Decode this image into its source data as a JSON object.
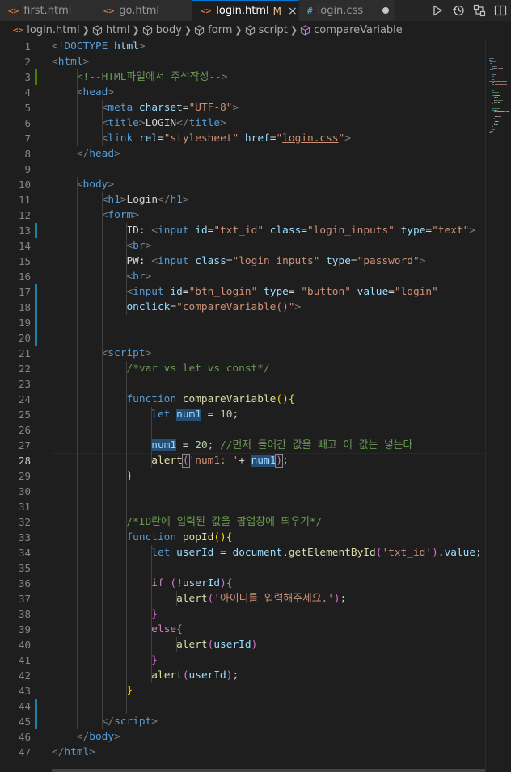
{
  "tabs": [
    {
      "label": "first.html",
      "icon": "<>",
      "type": "html",
      "active": false
    },
    {
      "label": "go.html",
      "icon": "<>",
      "type": "html",
      "active": false
    },
    {
      "label": "login.html",
      "icon": "<>",
      "type": "html",
      "active": true,
      "modified": "M",
      "close": "×"
    },
    {
      "label": "login.css",
      "icon": "#",
      "type": "css",
      "active": false,
      "dirty": true
    }
  ],
  "breadcrumb": [
    "login.html",
    "html",
    "body",
    "form",
    "script",
    "compareVariable"
  ],
  "current_line": 28,
  "lines": [
    {
      "n": 1,
      "t": [
        [
          "br",
          "<!"
        ],
        [
          "tag",
          "DOCTYPE"
        ],
        [
          "txt",
          " "
        ],
        [
          "attr",
          "html"
        ],
        [
          "br",
          ">"
        ]
      ]
    },
    {
      "n": 2,
      "t": [
        [
          "br",
          "<"
        ],
        [
          "tag",
          "html"
        ],
        [
          "br",
          ">"
        ]
      ]
    },
    {
      "n": 3,
      "g": "add",
      "t": [
        [
          "txt",
          "    "
        ],
        [
          "com",
          "<!--HTML파일에서 주석작성-->"
        ]
      ]
    },
    {
      "n": 4,
      "t": [
        [
          "txt",
          "    "
        ],
        [
          "br",
          "<"
        ],
        [
          "tag",
          "head"
        ],
        [
          "br",
          ">"
        ]
      ]
    },
    {
      "n": 5,
      "t": [
        [
          "txt",
          "        "
        ],
        [
          "br",
          "<"
        ],
        [
          "tag",
          "meta"
        ],
        [
          "txt",
          " "
        ],
        [
          "attr",
          "charset"
        ],
        [
          "txt",
          "="
        ],
        [
          "str",
          "\"UTF-8\""
        ],
        [
          "br",
          ">"
        ]
      ]
    },
    {
      "n": 6,
      "t": [
        [
          "txt",
          "        "
        ],
        [
          "br",
          "<"
        ],
        [
          "tag",
          "title"
        ],
        [
          "br",
          ">"
        ],
        [
          "txt",
          "LOGIN"
        ],
        [
          "br",
          "</"
        ],
        [
          "tag",
          "title"
        ],
        [
          "br",
          ">"
        ]
      ]
    },
    {
      "n": 7,
      "t": [
        [
          "txt",
          "        "
        ],
        [
          "br",
          "<"
        ],
        [
          "tag",
          "link"
        ],
        [
          "txt",
          " "
        ],
        [
          "attr",
          "rel"
        ],
        [
          "txt",
          "="
        ],
        [
          "str",
          "\"stylesheet\""
        ],
        [
          "txt",
          " "
        ],
        [
          "attr",
          "href"
        ],
        [
          "txt",
          "="
        ],
        [
          "str",
          "\""
        ],
        [
          "strul",
          "login.css"
        ],
        [
          "str",
          "\""
        ],
        [
          "br",
          ">"
        ]
      ]
    },
    {
      "n": 8,
      "t": [
        [
          "txt",
          "    "
        ],
        [
          "br",
          "</"
        ],
        [
          "tag",
          "head"
        ],
        [
          "br",
          ">"
        ]
      ]
    },
    {
      "n": 9,
      "t": []
    },
    {
      "n": 10,
      "t": [
        [
          "txt",
          "    "
        ],
        [
          "br",
          "<"
        ],
        [
          "tag",
          "body"
        ],
        [
          "br",
          ">"
        ]
      ]
    },
    {
      "n": 11,
      "t": [
        [
          "txt",
          "        "
        ],
        [
          "br",
          "<"
        ],
        [
          "tag",
          "h1"
        ],
        [
          "br",
          ">"
        ],
        [
          "txt",
          "Login"
        ],
        [
          "br",
          "</"
        ],
        [
          "tag",
          "h1"
        ],
        [
          "br",
          ">"
        ]
      ]
    },
    {
      "n": 12,
      "t": [
        [
          "txt",
          "        "
        ],
        [
          "br",
          "<"
        ],
        [
          "tag",
          "form"
        ],
        [
          "br",
          ">"
        ]
      ]
    },
    {
      "n": 13,
      "g": "mod",
      "t": [
        [
          "txt",
          "            ID: "
        ],
        [
          "br",
          "<"
        ],
        [
          "tag",
          "input"
        ],
        [
          "txt",
          " "
        ],
        [
          "attr",
          "id"
        ],
        [
          "txt",
          "="
        ],
        [
          "str",
          "\"txt_id\""
        ],
        [
          "txt",
          " "
        ],
        [
          "attr",
          "class"
        ],
        [
          "txt",
          "="
        ],
        [
          "str",
          "\"login_inputs\""
        ],
        [
          "txt",
          " "
        ],
        [
          "attr",
          "type"
        ],
        [
          "txt",
          "="
        ],
        [
          "str",
          "\"text\""
        ],
        [
          "br",
          ">"
        ]
      ]
    },
    {
      "n": 14,
      "t": [
        [
          "txt",
          "            "
        ],
        [
          "br",
          "<"
        ],
        [
          "tag",
          "br"
        ],
        [
          "br",
          ">"
        ]
      ]
    },
    {
      "n": 15,
      "t": [
        [
          "txt",
          "            PW: "
        ],
        [
          "br",
          "<"
        ],
        [
          "tag",
          "input"
        ],
        [
          "txt",
          " "
        ],
        [
          "attr",
          "class"
        ],
        [
          "txt",
          "="
        ],
        [
          "str",
          "\"login_inputs\""
        ],
        [
          "txt",
          " "
        ],
        [
          "attr",
          "type"
        ],
        [
          "txt",
          "="
        ],
        [
          "str",
          "\"password\""
        ],
        [
          "br",
          ">"
        ]
      ]
    },
    {
      "n": 16,
      "t": [
        [
          "txt",
          "            "
        ],
        [
          "br",
          "<"
        ],
        [
          "tag",
          "br"
        ],
        [
          "br",
          ">"
        ]
      ]
    },
    {
      "n": 17,
      "g": "mod",
      "t": [
        [
          "txt",
          "            "
        ],
        [
          "br",
          "<"
        ],
        [
          "tag",
          "input"
        ],
        [
          "txt",
          " "
        ],
        [
          "attr",
          "id"
        ],
        [
          "txt",
          "="
        ],
        [
          "str",
          "\"btn_login\""
        ],
        [
          "txt",
          " "
        ],
        [
          "attr",
          "type"
        ],
        [
          "txt",
          "= "
        ],
        [
          "str",
          "\"button\""
        ],
        [
          "txt",
          " "
        ],
        [
          "attr",
          "value"
        ],
        [
          "txt",
          "="
        ],
        [
          "str",
          "\"login\""
        ]
      ]
    },
    {
      "n": 18,
      "g": "mod",
      "t": [
        [
          "txt",
          "            "
        ],
        [
          "attr",
          "onclick"
        ],
        [
          "txt",
          "="
        ],
        [
          "str",
          "\"compareVariable()\""
        ],
        [
          "br",
          ">"
        ]
      ]
    },
    {
      "n": 19,
      "g": "mod",
      "t": []
    },
    {
      "n": 20,
      "g": "mod",
      "t": []
    },
    {
      "n": 21,
      "t": [
        [
          "txt",
          "        "
        ],
        [
          "br",
          "<"
        ],
        [
          "tag",
          "script"
        ],
        [
          "br",
          ">"
        ]
      ]
    },
    {
      "n": 22,
      "t": [
        [
          "txt",
          "            "
        ],
        [
          "com",
          "/*var vs let vs const*/"
        ]
      ]
    },
    {
      "n": 23,
      "t": []
    },
    {
      "n": 24,
      "t": [
        [
          "txt",
          "            "
        ],
        [
          "kw",
          "function"
        ],
        [
          "txt",
          " "
        ],
        [
          "fn",
          "compareVariable"
        ],
        [
          "p1",
          "()"
        ],
        [
          "p1",
          "{"
        ]
      ]
    },
    {
      "n": 25,
      "t": [
        [
          "txt",
          "                "
        ],
        [
          "kw",
          "let"
        ],
        [
          "txt",
          " "
        ],
        [
          "varhl",
          "num1"
        ],
        [
          "txt",
          " = "
        ],
        [
          "num",
          "10"
        ],
        [
          "txt",
          ";"
        ]
      ]
    },
    {
      "n": 26,
      "t": []
    },
    {
      "n": 27,
      "t": [
        [
          "txt",
          "                "
        ],
        [
          "varhl",
          "num1"
        ],
        [
          "txt",
          " = "
        ],
        [
          "num",
          "20"
        ],
        [
          "txt",
          "; "
        ],
        [
          "com",
          "//먼저 들어간 값을 빼고 이 값는 넣는다"
        ]
      ]
    },
    {
      "n": 28,
      "t": [
        [
          "txt",
          "                "
        ],
        [
          "fn",
          "alert"
        ],
        [
          "p2box",
          "("
        ],
        [
          "str",
          "'num1: '"
        ],
        [
          "txt",
          "+ "
        ],
        [
          "varhl",
          "num1"
        ],
        [
          "p2box",
          ")"
        ],
        [
          "txt",
          ";"
        ]
      ]
    },
    {
      "n": 29,
      "t": [
        [
          "txt",
          "            "
        ],
        [
          "p1",
          "}"
        ]
      ]
    },
    {
      "n": 30,
      "t": []
    },
    {
      "n": 31,
      "t": []
    },
    {
      "n": 32,
      "t": [
        [
          "txt",
          "            "
        ],
        [
          "com",
          "/*ID란에 입력된 값을 팝업창에 띄우기*/"
        ]
      ]
    },
    {
      "n": 33,
      "t": [
        [
          "txt",
          "            "
        ],
        [
          "kw",
          "function"
        ],
        [
          "txt",
          " "
        ],
        [
          "fn",
          "popId"
        ],
        [
          "p1",
          "()"
        ],
        [
          "p1",
          "{"
        ]
      ]
    },
    {
      "n": 34,
      "t": [
        [
          "txt",
          "                "
        ],
        [
          "kw",
          "let"
        ],
        [
          "txt",
          " "
        ],
        [
          "var",
          "userId"
        ],
        [
          "txt",
          " = "
        ],
        [
          "var",
          "document"
        ],
        [
          "txt",
          "."
        ],
        [
          "fn",
          "getElementById"
        ],
        [
          "p2",
          "("
        ],
        [
          "str",
          "'txt_id'"
        ],
        [
          "p2",
          ")"
        ],
        [
          "txt",
          "."
        ],
        [
          "var",
          "value"
        ],
        [
          "txt",
          ";"
        ]
      ]
    },
    {
      "n": 35,
      "t": []
    },
    {
      "n": 36,
      "t": [
        [
          "txt",
          "                "
        ],
        [
          "ctl",
          "if"
        ],
        [
          "txt",
          " "
        ],
        [
          "p2",
          "("
        ],
        [
          "txt",
          "!"
        ],
        [
          "var",
          "userId"
        ],
        [
          "p2",
          ")"
        ],
        [
          "p2",
          "{"
        ]
      ]
    },
    {
      "n": 37,
      "t": [
        [
          "txt",
          "                    "
        ],
        [
          "fn",
          "alert"
        ],
        [
          "p2",
          "("
        ],
        [
          "str",
          "'아이디를 입력해주세요.'"
        ],
        [
          "p2",
          ")"
        ],
        [
          "txt",
          ";"
        ]
      ]
    },
    {
      "n": 38,
      "t": [
        [
          "txt",
          "                "
        ],
        [
          "p2",
          "}"
        ]
      ]
    },
    {
      "n": 39,
      "t": [
        [
          "txt",
          "                "
        ],
        [
          "ctl",
          "else"
        ],
        [
          "p2",
          "{"
        ]
      ]
    },
    {
      "n": 40,
      "t": [
        [
          "txt",
          "                    "
        ],
        [
          "fn",
          "alert"
        ],
        [
          "p2",
          "("
        ],
        [
          "var",
          "userId"
        ],
        [
          "p2",
          ")"
        ]
      ]
    },
    {
      "n": 41,
      "t": [
        [
          "txt",
          "                "
        ],
        [
          "p2",
          "}"
        ]
      ]
    },
    {
      "n": 42,
      "t": [
        [
          "txt",
          "                "
        ],
        [
          "fn",
          "alert"
        ],
        [
          "p2",
          "("
        ],
        [
          "var",
          "userId"
        ],
        [
          "p2",
          ")"
        ],
        [
          "txt",
          ";"
        ]
      ]
    },
    {
      "n": 43,
      "t": [
        [
          "txt",
          "            "
        ],
        [
          "p1",
          "}"
        ]
      ]
    },
    {
      "n": 44,
      "g": "mod",
      "t": []
    },
    {
      "n": 45,
      "g": "mod",
      "t": [
        [
          "txt",
          "        "
        ],
        [
          "br",
          "</"
        ],
        [
          "tag",
          "script"
        ],
        [
          "br",
          ">"
        ]
      ]
    },
    {
      "n": 46,
      "t": [
        [
          "txt",
          "    "
        ],
        [
          "br",
          "</"
        ],
        [
          "tag",
          "body"
        ],
        [
          "br",
          ">"
        ]
      ]
    },
    {
      "n": 47,
      "t": [
        [
          "br",
          "</"
        ],
        [
          "tag",
          "html"
        ],
        [
          "br",
          ">"
        ]
      ]
    }
  ]
}
